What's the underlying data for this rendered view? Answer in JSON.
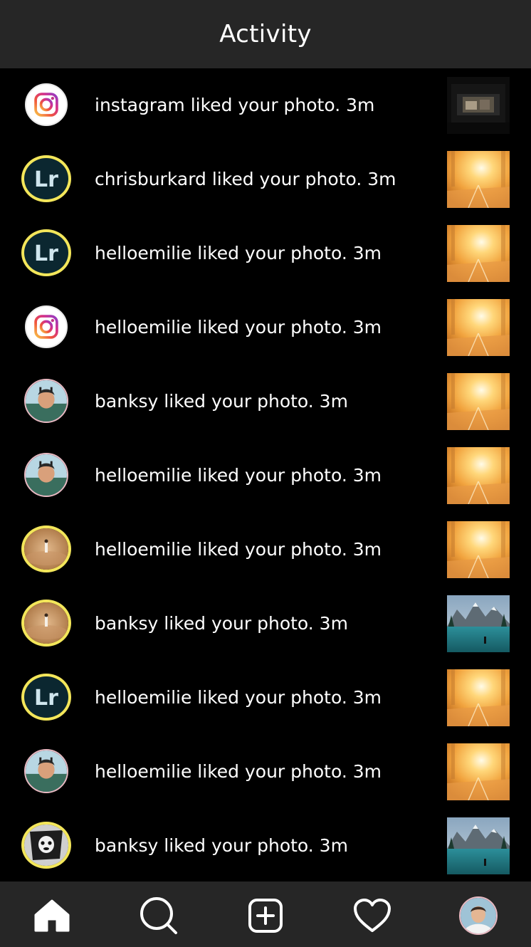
{
  "header": {
    "title": "Activity"
  },
  "activity": [
    {
      "text": "instagram liked your photo. 3m",
      "avatar": "instagram-icon",
      "thumb": "dark-room"
    },
    {
      "text": "chrisburkard liked your photo. 3m",
      "avatar": "lightroom-icon",
      "thumb": "sunset-road"
    },
    {
      "text": "helloemilie liked your photo. 3m",
      "avatar": "lightroom-icon",
      "thumb": "sunset-road"
    },
    {
      "text": "helloemilie liked your photo. 3m",
      "avatar": "instagram-icon",
      "thumb": "sunset-road"
    },
    {
      "text": "banksy liked your photo. 3m",
      "avatar": "person-avatar",
      "thumb": "sunset-road"
    },
    {
      "text": "helloemilie liked your photo. 3m",
      "avatar": "person-avatar",
      "thumb": "sunset-road"
    },
    {
      "text": "helloemilie liked your photo. 3m",
      "avatar": "desert-avatar",
      "thumb": "sunset-road"
    },
    {
      "text": "banksy liked your photo. 3m",
      "avatar": "desert-avatar",
      "thumb": "mountain-lake"
    },
    {
      "text": "helloemilie liked your photo. 3m",
      "avatar": "lightroom-icon",
      "thumb": "sunset-road"
    },
    {
      "text": "helloemilie liked your photo. 3m",
      "avatar": "person-avatar",
      "thumb": "sunset-road"
    },
    {
      "text": "banksy liked your photo. 3m",
      "avatar": "bw-avatar",
      "thumb": "mountain-lake"
    }
  ],
  "tabs": [
    "home-icon",
    "search-icon",
    "add-post-icon",
    "heart-icon",
    "profile-avatar"
  ],
  "colors": {
    "background": "#000000",
    "bars": "#262626",
    "story_ring": "#f3e65a",
    "text": "#ffffff"
  }
}
